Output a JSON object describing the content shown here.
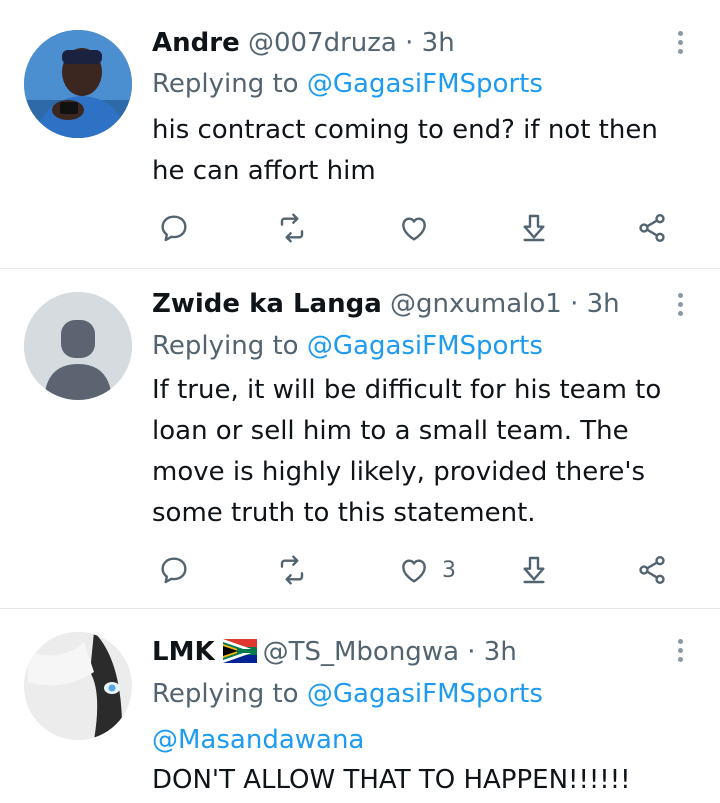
{
  "tweets": [
    {
      "name": "Andre",
      "handle": "@007druza",
      "time": "· 3h",
      "replying_label": "Replying to",
      "replying_to": "@GagasiFMSports",
      "text": "his contract coming to end? if not then he can affort him",
      "likes": ""
    },
    {
      "name": "Zwide ka Langa",
      "handle": "@gnxumalo1",
      "time": "· 3h",
      "replying_label": "Replying to",
      "replying_to": "@GagasiFMSports",
      "text": "If true, it will be difficult for his team to loan or sell him to a small team. The move is highly likely, provided there's some truth to this statement.",
      "likes": "3"
    },
    {
      "name": "LMK",
      "handle": "@TS_Mbongwa",
      "time": "· 3h",
      "replying_label": "Replying to",
      "replying_to": "@GagasiFMSports",
      "mention": "@Masandawana",
      "text": "DON'T ALLOW THAT TO HAPPEN!!!!!!"
    }
  ],
  "icons": [
    "reply-icon",
    "retweet-icon",
    "like-icon",
    "bookmark-icon",
    "share-icon",
    "more-icon",
    "south-africa-flag-icon"
  ],
  "colors": {
    "accent": "#1d9bf0",
    "secondary_text": "#536471",
    "divider": "#e6e9ec"
  }
}
